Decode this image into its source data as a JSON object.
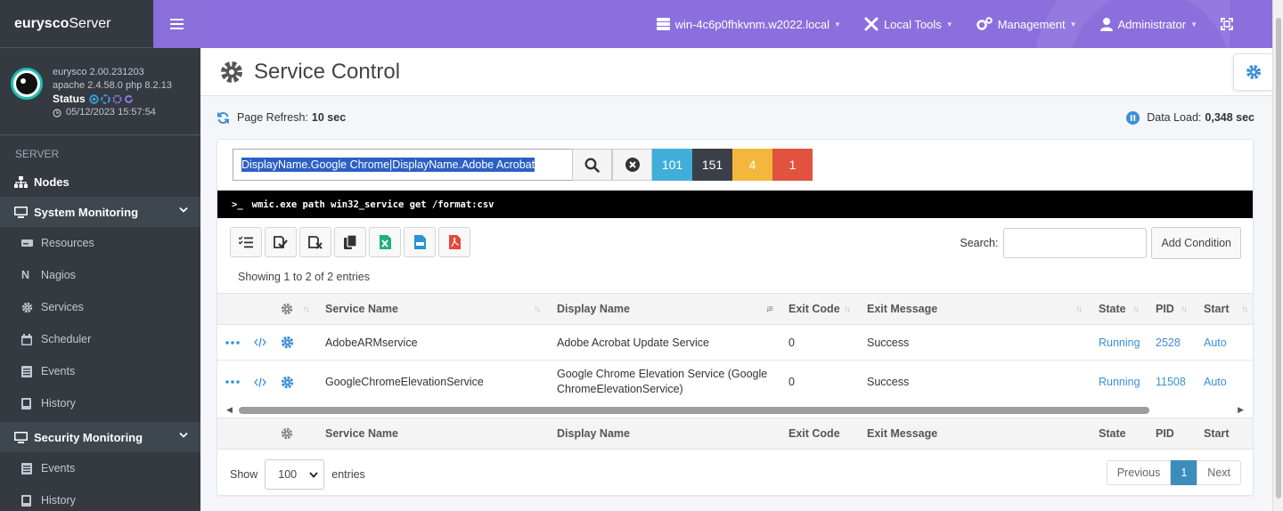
{
  "brand": {
    "bold": "eurysco",
    "rest": "Server"
  },
  "topnav": {
    "host": "win-4c6p0fhkvnm.w2022.local",
    "local_tools": "Local Tools",
    "management": "Management",
    "user": "Administrator"
  },
  "sysinfo": {
    "version": "eurysco 2.00.231203",
    "stack": "apache 2.4.58.0  php 8.2.13",
    "status_label": "Status",
    "timestamp": "05/12/2023 15:57:54"
  },
  "sidebar": {
    "header": "SERVER",
    "nodes": "Nodes",
    "system_monitoring": "System Monitoring",
    "sys_items": [
      "Resources",
      "Nagios",
      "Services",
      "Scheduler",
      "Events",
      "History"
    ],
    "security_monitoring": "Security Monitoring",
    "sec_items": [
      "Events",
      "History"
    ]
  },
  "page": {
    "title": "Service Control"
  },
  "refresh": {
    "label": "Page Refresh:",
    "value": "10 sec"
  },
  "dataload": {
    "label": "Data Load:",
    "value": "0,348 sec"
  },
  "filter": {
    "query": "DisplayName.Google Chrome|DisplayName.Adobe Acrobat",
    "badges": [
      {
        "value": "101",
        "color": "#3fafda"
      },
      {
        "value": "151",
        "color": "#3b4048"
      },
      {
        "value": "4",
        "color": "#f3b73e"
      },
      {
        "value": "1",
        "color": "#e2533f"
      }
    ]
  },
  "command": "wmic.exe path win32_service get /format:csv",
  "search": {
    "label": "Search:",
    "add_condition": "Add Condition"
  },
  "table": {
    "info": "Showing 1 to 2 of 2 entries",
    "columns": [
      "Service Name",
      "Display Name",
      "Exit Code",
      "Exit Message",
      "State",
      "PID",
      "Start"
    ],
    "rows": [
      {
        "service_name": "AdobeARMservice",
        "display_name": "Adobe Acrobat Update Service",
        "exit_code": "0",
        "exit_message": "Success",
        "state": "Running",
        "pid": "2528",
        "start": "Auto"
      },
      {
        "service_name": "GoogleChromeElevationService",
        "display_name": "Google Chrome Elevation Service (GoogleChromeElevationService)",
        "exit_code": "0",
        "exit_message": "Success",
        "state": "Running",
        "pid": "11508",
        "start": "Auto"
      }
    ]
  },
  "length": {
    "show": "Show",
    "value": "100",
    "entries": "entries"
  },
  "pager": {
    "previous": "Previous",
    "current": "1",
    "next": "Next"
  },
  "colors": {
    "navbar": "#8b6fdc",
    "sidebar": "#343a40",
    "link": "#3a8fd9"
  }
}
